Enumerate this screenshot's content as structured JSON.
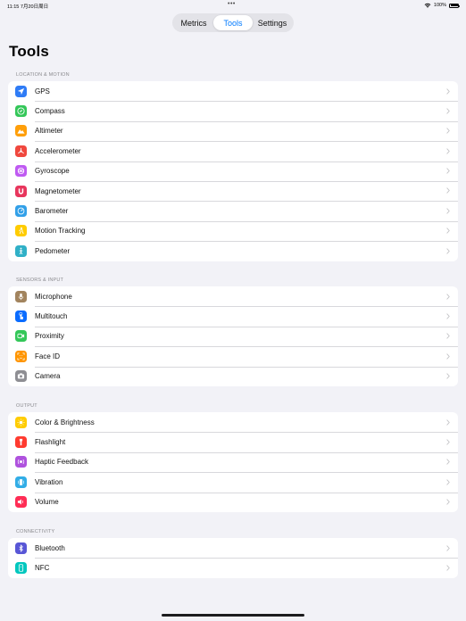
{
  "status": {
    "time": "11:15",
    "date": "7月20日周日",
    "dots": "•••",
    "battery": "100%"
  },
  "tabs": [
    {
      "label": "Metrics",
      "active": false
    },
    {
      "label": "Tools",
      "active": true
    },
    {
      "label": "Settings",
      "active": false
    }
  ],
  "page": {
    "title": "Tools"
  },
  "sections": [
    {
      "header": "LOCATION & MOTION",
      "items": [
        {
          "label": "GPS",
          "icon": "location-arrow-icon",
          "color": "#2f7cf6"
        },
        {
          "label": "Compass",
          "icon": "compass-icon",
          "color": "#34c759"
        },
        {
          "label": "Altimeter",
          "icon": "mountain-icon",
          "color": "#ff9f0a"
        },
        {
          "label": "Accelerometer",
          "icon": "accelerometer-icon",
          "color": "#f0483e"
        },
        {
          "label": "Gyroscope",
          "icon": "gyroscope-icon",
          "color": "#bf5af2"
        },
        {
          "label": "Magnetometer",
          "icon": "magnet-icon",
          "color": "#e8365d"
        },
        {
          "label": "Barometer",
          "icon": "gauge-icon",
          "color": "#32a0e8"
        },
        {
          "label": "Motion Tracking",
          "icon": "motion-icon",
          "color": "#ffcc00"
        },
        {
          "label": "Pedometer",
          "icon": "walking-figure-icon",
          "color": "#30b0c7"
        }
      ]
    },
    {
      "header": "SENSORS & INPUT",
      "items": [
        {
          "label": "Microphone",
          "icon": "microphone-icon",
          "color": "#a2845e"
        },
        {
          "label": "Multitouch",
          "icon": "hand-touch-icon",
          "color": "#0a6cff"
        },
        {
          "label": "Proximity",
          "icon": "proximity-icon",
          "color": "#34c759"
        },
        {
          "label": "Face ID",
          "icon": "face-id-icon",
          "color": "#ff9500"
        },
        {
          "label": "Camera",
          "icon": "camera-icon",
          "color": "#8e8e93"
        }
      ]
    },
    {
      "header": "OUTPUT",
      "items": [
        {
          "label": "Color & Brightness",
          "icon": "sun-icon",
          "color": "#ffcc00"
        },
        {
          "label": "Flashlight",
          "icon": "flashlight-icon",
          "color": "#ff3b30"
        },
        {
          "label": "Haptic Feedback",
          "icon": "haptic-icon",
          "color": "#af52de"
        },
        {
          "label": "Vibration",
          "icon": "vibration-icon",
          "color": "#32ade6"
        },
        {
          "label": "Volume",
          "icon": "speaker-icon",
          "color": "#ff2d55"
        }
      ]
    },
    {
      "header": "CONNECTIVITY",
      "items": [
        {
          "label": "Bluetooth",
          "icon": "bluetooth-icon",
          "color": "#5856d6"
        },
        {
          "label": "NFC",
          "icon": "nfc-icon",
          "color": "#00c7be"
        }
      ]
    }
  ]
}
